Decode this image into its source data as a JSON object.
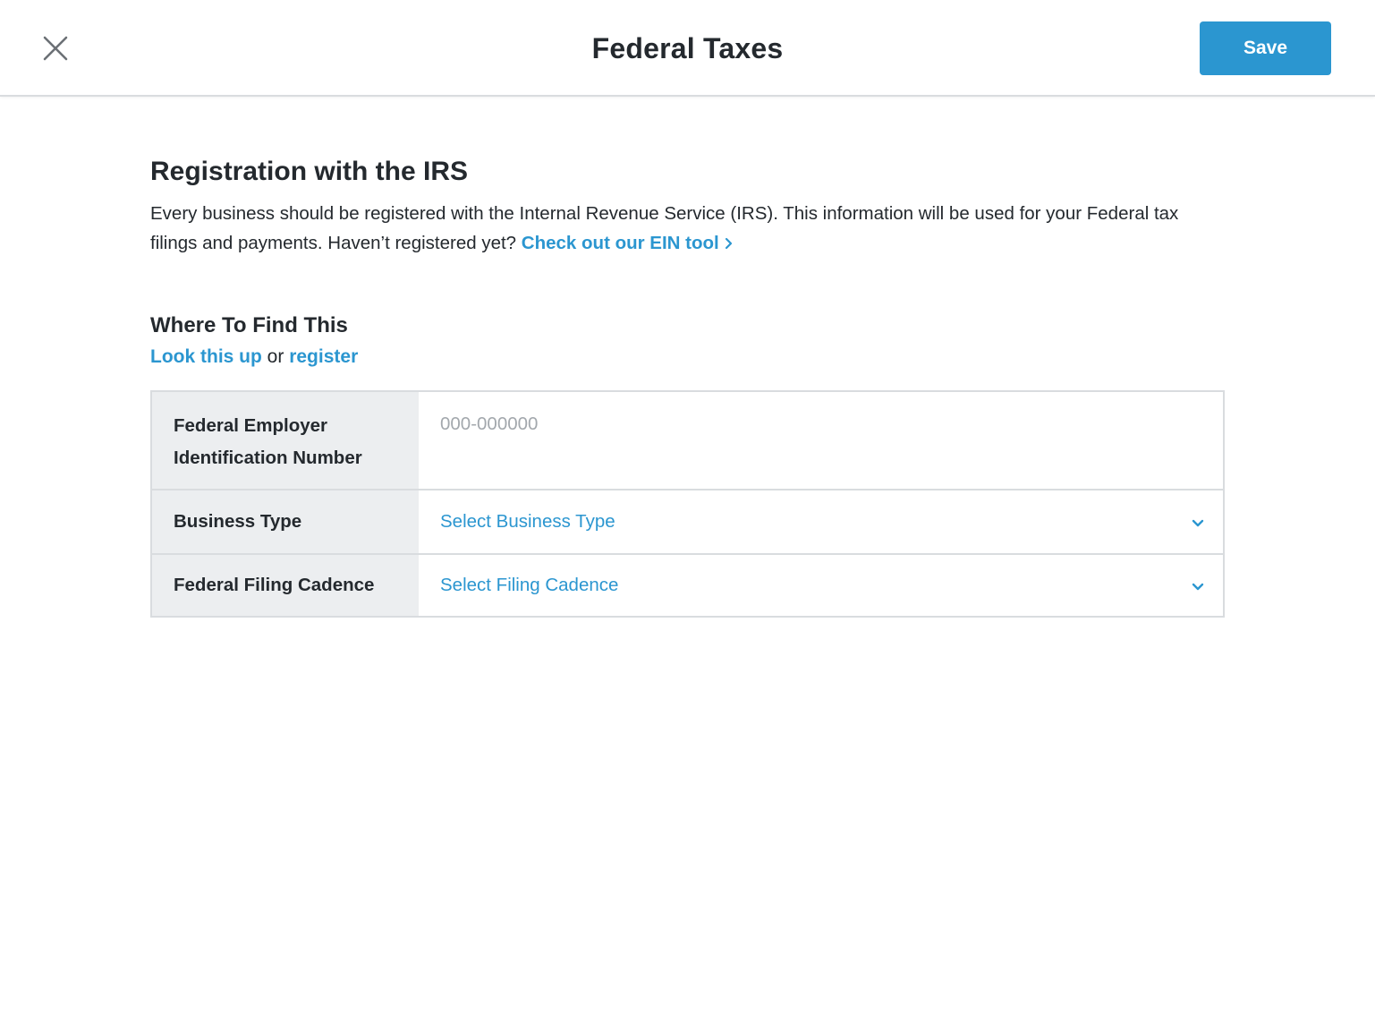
{
  "header": {
    "title": "Federal Taxes",
    "save_label": "Save",
    "close_icon": "close-icon"
  },
  "registration": {
    "title": "Registration with the IRS",
    "description": "Every business should be registered with the  Internal Revenue Service (IRS). This information will be used for your Federal tax filings and payments. Haven’t registered yet?",
    "ein_tool_link": "Check out our EIN tool"
  },
  "find": {
    "title": "Where To Find This",
    "lookup_link": "Look this up",
    "or_text": "or",
    "register_link": "register"
  },
  "form": {
    "ein": {
      "label": "Federal Employer Identification Number",
      "value": "",
      "placeholder": "000-000000"
    },
    "business_type": {
      "label": "Business Type",
      "selected": "Select Business Type"
    },
    "filing_cadence": {
      "label": "Federal Filing Cadence",
      "selected": "Select Filing Cadence"
    }
  },
  "colors": {
    "accent": "#2b96d0",
    "label_bg": "#eceef0",
    "border": "#d9dcdf",
    "text": "#24292e",
    "placeholder": "#a3a8ad"
  }
}
